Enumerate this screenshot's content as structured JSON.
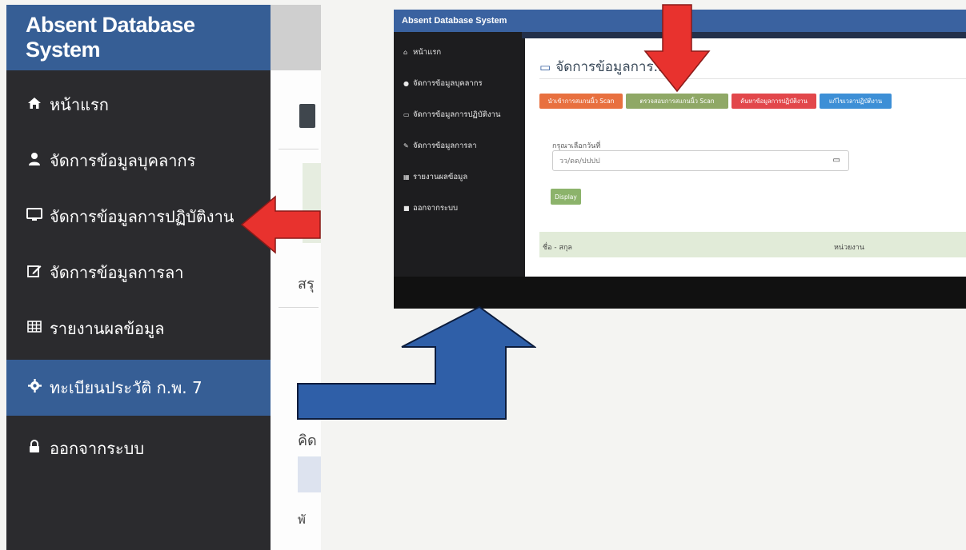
{
  "left_panel": {
    "brand": "Absent Database System",
    "nav": [
      {
        "icon": "home-icon",
        "label": "หน้าแรก",
        "active": false
      },
      {
        "icon": "user-icon",
        "label": "จัดการข้อมูลบุคลากร",
        "active": false
      },
      {
        "icon": "monitor-icon",
        "label": "จัดการข้อมูลการปฏิบัติงาน",
        "active": false
      },
      {
        "icon": "edit-icon",
        "label": "จัดการข้อมูลการลา",
        "active": false
      },
      {
        "icon": "table-icon",
        "label": "รายงานผลข้อมูล",
        "active": false
      },
      {
        "icon": "gear-icon",
        "label": "ทะเบียนประวัติ ก.พ. 7",
        "active": true
      },
      {
        "icon": "lock-icon",
        "label": "ออกจากระบบ",
        "active": false
      }
    ],
    "cropped_texts": [
      "สรุ",
      "คิด",
      "พั"
    ]
  },
  "inset": {
    "brand": "Absent Database System",
    "nav": [
      {
        "icon": "home-icon",
        "label": "หน้าแรก"
      },
      {
        "icon": "user-icon",
        "label": "จัดการข้อมูลบุคลากร"
      },
      {
        "icon": "monitor-icon",
        "label": "จัดการข้อมูลการปฏิบัติงาน"
      },
      {
        "icon": "edit-icon",
        "label": "จัดการข้อมูลการลา"
      },
      {
        "icon": "table-icon",
        "label": "รายงานผลข้อมูล"
      },
      {
        "icon": "lock-icon",
        "label": "ออกจากระบบ"
      }
    ],
    "page_title": "จัดการข้อมูลการ...งาน",
    "buttons": [
      {
        "label": "นำเข้าการสแกนนิ้ว Scan",
        "color": "#e8703f"
      },
      {
        "label": "ตรวจสอบการสแกนนิ้ว Scan",
        "color": "#8fa866"
      },
      {
        "label": "ค้นหาข้อมูลการปฏิบัติงาน",
        "color": "#e2474b"
      },
      {
        "label": "แก้ไขเวลาปฏิบัติงาน",
        "color": "#3d8fd6"
      }
    ],
    "date_label": "กรุณาเลือกวันที่",
    "date_placeholder": "วว/ดด/ปปปป",
    "display_button": "Display",
    "table_headers": [
      "ชื่อ - สกุล",
      "หน่วยงาน"
    ]
  },
  "colors": {
    "sidebar_bg": "#2b2b2e",
    "brand_blue": "#365e95",
    "red_arrow": "#e8322e",
    "blue_arrow": "#2f5fa8"
  }
}
